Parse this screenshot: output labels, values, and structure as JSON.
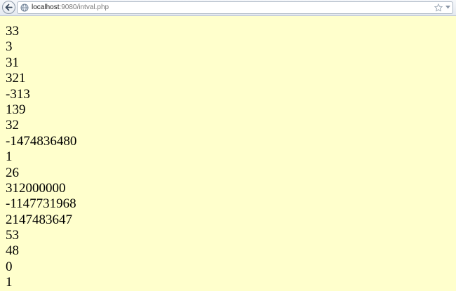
{
  "browser": {
    "url_host": "localhost",
    "url_rest": ":9080/intval.php"
  },
  "page": {
    "lines": [
      "33",
      "3",
      "31",
      "321",
      "-313",
      "139",
      "32",
      "-1474836480",
      "1",
      "26",
      "312000000",
      "-1147731968",
      "2147483647",
      "53",
      "48",
      "0",
      "1"
    ],
    "background": "#ffffcc"
  }
}
